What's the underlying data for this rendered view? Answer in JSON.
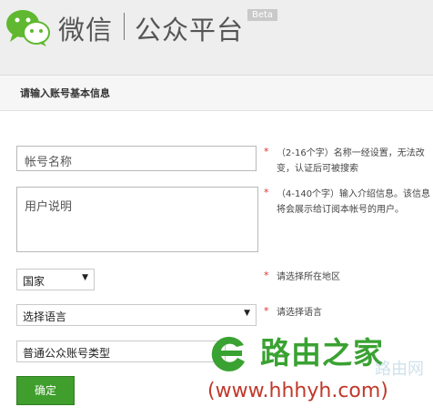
{
  "header": {
    "brand_wechat": "微信",
    "brand_platform": "公众平台",
    "badge": "Beta"
  },
  "section": {
    "title": "请输入账号基本信息"
  },
  "form": {
    "account_name": {
      "value": "帐号名称",
      "required_mark": "*",
      "hint": "（2-16个字）名称一经设置，无法改变，认证后可被搜索"
    },
    "description": {
      "value": "用户说明",
      "required_mark": "*",
      "hint": "（4-140个字）输入介绍信息。该信息将会展示给订阅本帐号的用户。"
    },
    "country": {
      "value": "国家",
      "required_mark": "*",
      "hint": "请选择所在地区"
    },
    "language": {
      "value": "选择语言",
      "required_mark": "*",
      "hint": "请选择语言"
    },
    "account_type": {
      "value": "普通公众账号类型"
    },
    "confirm_label": "确定"
  },
  "watermark": {
    "name": "路由之家",
    "url": "(www.hhhyh.com)",
    "faint": "路由网"
  },
  "colors": {
    "accent_green": "#3f9e2c",
    "required_red": "#d33333",
    "watermark_green": "#3aa232",
    "watermark_red": "#c0392b"
  }
}
